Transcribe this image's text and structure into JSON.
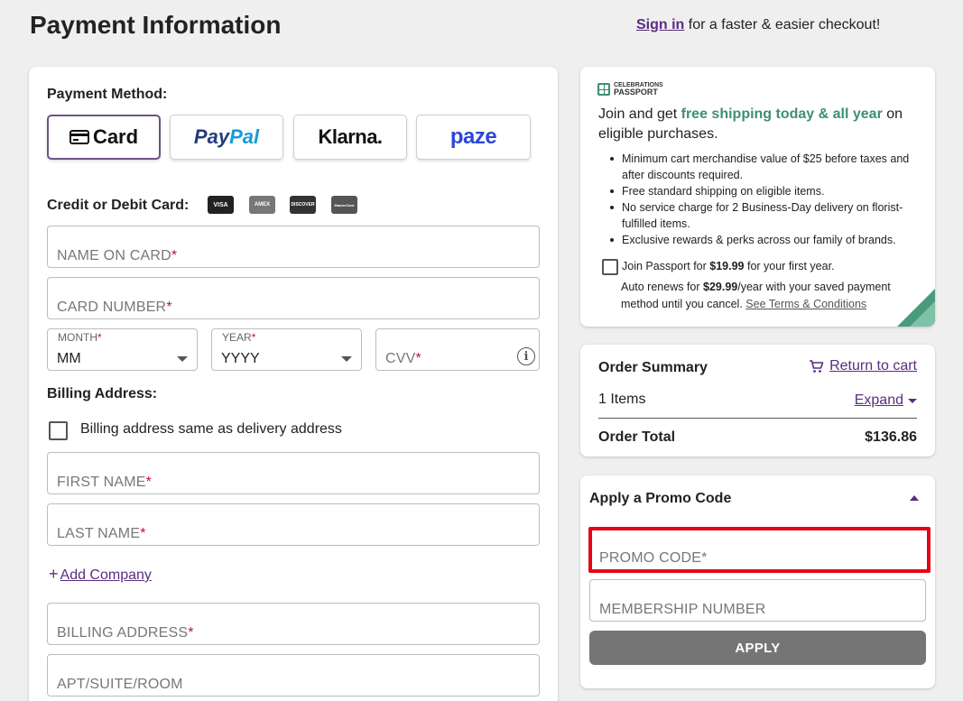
{
  "header": {
    "title": "Payment Information",
    "signin_link": "Sign in",
    "signin_text": "for a faster & easier checkout!"
  },
  "payment": {
    "method_label": "Payment Method:",
    "methods": {
      "card": "Card",
      "paypal_a": "Pay",
      "paypal_b": "Pal",
      "klarna": "Klarna.",
      "paze": "paze"
    },
    "card_label": "Credit or Debit Card:",
    "card_logos": {
      "visa": "VISA",
      "amex": "AMEX",
      "discover": "DISCOVER",
      "mastercard": "MasterCard"
    },
    "name_on_card": "NAME ON CARD",
    "card_number": "CARD NUMBER",
    "month_label": "MONTH",
    "month_value": "MM",
    "year_label": "YEAR",
    "year_value": "YYYY",
    "cvv": "CVV",
    "info_glyph": "i",
    "required_mark": "*"
  },
  "billing": {
    "label": "Billing Address:",
    "same_as_delivery": "Billing address same as delivery address",
    "first_name": "FIRST NAME",
    "last_name": "LAST NAME",
    "add_company_plus": "+",
    "add_company": "Add Company",
    "billing_address": "BILLING ADDRESS",
    "apt": "APT/SUITE/ROOM"
  },
  "passport": {
    "logo_small": "CELEBRATIONS",
    "logo_big": "PASSPORT",
    "head_a": "Join and get ",
    "head_highlight": "free shipping today & all year",
    "head_b": " on eligible purchases.",
    "bullets": [
      "Minimum cart merchandise value of $25 before taxes and after discounts required.",
      "Free standard shipping on eligible items.",
      "No service charge for 2 Business-Day delivery on florist-fulfilled items.",
      "Exclusive rewards & perks across our family of brands."
    ],
    "join_a": "Join Passport for ",
    "join_price": "$19.99",
    "join_b": " for your first year.",
    "auto_a": "Auto renews for ",
    "auto_price": "$29.99",
    "auto_b": "/year with your saved payment method until you cancel. ",
    "terms_link": "See Terms & Conditions",
    "accent_color": "#3f8f73"
  },
  "summary": {
    "title": "Order Summary",
    "return_cart": "Return to cart",
    "items": "1 Items",
    "expand": "Expand",
    "total_label": "Order Total",
    "total_value": "$136.86"
  },
  "promo": {
    "title": "Apply a Promo Code",
    "promo_code": "PROMO CODE",
    "membership": "MEMBERSHIP NUMBER",
    "apply": "APPLY",
    "highlight_color": "#e30613"
  },
  "colors": {
    "brand_purple": "#5a2d82",
    "required_red": "#c8102e",
    "background": "#efefef"
  }
}
